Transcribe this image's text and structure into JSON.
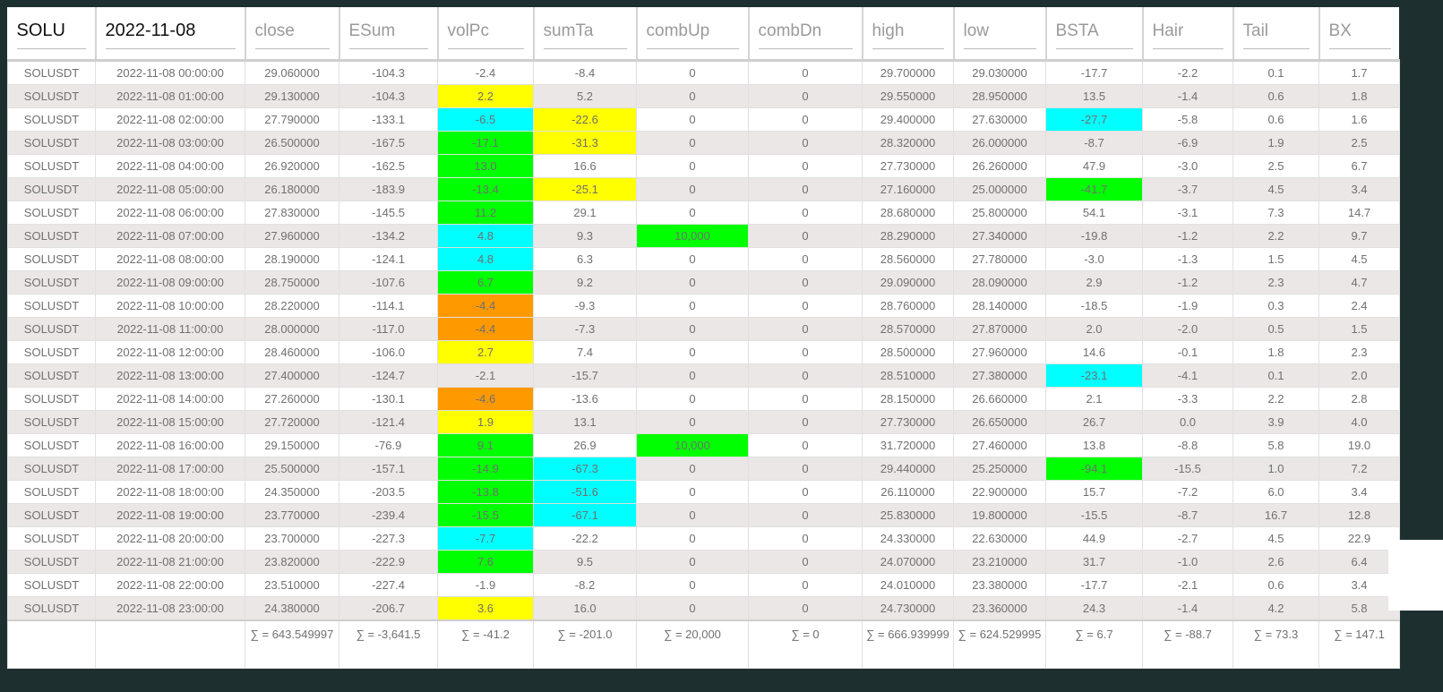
{
  "header": {
    "symbol": "SOLU",
    "date": "2022-11-08",
    "columns": [
      "close",
      "ESum",
      "volPc",
      "sumTa",
      "combUp",
      "combDn",
      "high",
      "low",
      "BSTA",
      "Hair",
      "Tail",
      "BX"
    ]
  },
  "colors": {
    "yellow": "#ffff00",
    "cyan": "#00ffff",
    "green": "#00ff00",
    "orange": "#ff9900"
  },
  "rows": [
    {
      "c": [
        "SOLUSDT",
        "2022-11-08 00:00:00",
        "29.060000",
        "-104.3",
        "-2.4",
        "-8.4",
        "0",
        "0",
        "29.700000",
        "29.030000",
        "-17.7",
        "-2.2",
        "0.1",
        "1.7"
      ],
      "hl": {}
    },
    {
      "c": [
        "SOLUSDT",
        "2022-11-08 01:00:00",
        "29.130000",
        "-104.3",
        "2.2",
        "5.2",
        "0",
        "0",
        "29.550000",
        "28.950000",
        "13.5",
        "-1.4",
        "0.6",
        "1.8"
      ],
      "hl": {
        "4": "yellow"
      }
    },
    {
      "c": [
        "SOLUSDT",
        "2022-11-08 02:00:00",
        "27.790000",
        "-133.1",
        "-6.5",
        "-22.6",
        "0",
        "0",
        "29.400000",
        "27.630000",
        "-27.7",
        "-5.8",
        "0.6",
        "1.6"
      ],
      "hl": {
        "4": "cyan",
        "5": "yellow",
        "10": "cyan"
      }
    },
    {
      "c": [
        "SOLUSDT",
        "2022-11-08 03:00:00",
        "26.500000",
        "-167.5",
        "-17.1",
        "-31.3",
        "0",
        "0",
        "28.320000",
        "26.000000",
        "-8.7",
        "-6.9",
        "1.9",
        "2.5"
      ],
      "hl": {
        "4": "green",
        "5": "yellow"
      }
    },
    {
      "c": [
        "SOLUSDT",
        "2022-11-08 04:00:00",
        "26.920000",
        "-162.5",
        "13.0",
        "16.6",
        "0",
        "0",
        "27.730000",
        "26.260000",
        "47.9",
        "-3.0",
        "2.5",
        "6.7"
      ],
      "hl": {
        "4": "green"
      }
    },
    {
      "c": [
        "SOLUSDT",
        "2022-11-08 05:00:00",
        "26.180000",
        "-183.9",
        "-13.4",
        "-25.1",
        "0",
        "0",
        "27.160000",
        "25.000000",
        "-41.7",
        "-3.7",
        "4.5",
        "3.4"
      ],
      "hl": {
        "4": "green",
        "5": "yellow",
        "10": "green"
      }
    },
    {
      "c": [
        "SOLUSDT",
        "2022-11-08 06:00:00",
        "27.830000",
        "-145.5",
        "11.2",
        "29.1",
        "0",
        "0",
        "28.680000",
        "25.800000",
        "54.1",
        "-3.1",
        "7.3",
        "14.7"
      ],
      "hl": {
        "4": "green"
      }
    },
    {
      "c": [
        "SOLUSDT",
        "2022-11-08 07:00:00",
        "27.960000",
        "-134.2",
        "4.8",
        "9.3",
        "10,000",
        "0",
        "28.290000",
        "27.340000",
        "-19.8",
        "-1.2",
        "2.2",
        "9.7"
      ],
      "hl": {
        "4": "cyan",
        "6": "green"
      }
    },
    {
      "c": [
        "SOLUSDT",
        "2022-11-08 08:00:00",
        "28.190000",
        "-124.1",
        "4.8",
        "6.3",
        "0",
        "0",
        "28.560000",
        "27.780000",
        "-3.0",
        "-1.3",
        "1.5",
        "4.5"
      ],
      "hl": {
        "4": "cyan"
      }
    },
    {
      "c": [
        "SOLUSDT",
        "2022-11-08 09:00:00",
        "28.750000",
        "-107.6",
        "6.7",
        "9.2",
        "0",
        "0",
        "29.090000",
        "28.090000",
        "2.9",
        "-1.2",
        "2.3",
        "4.7"
      ],
      "hl": {
        "4": "green"
      }
    },
    {
      "c": [
        "SOLUSDT",
        "2022-11-08 10:00:00",
        "28.220000",
        "-114.1",
        "-4.4",
        "-9.3",
        "0",
        "0",
        "28.760000",
        "28.140000",
        "-18.5",
        "-1.9",
        "0.3",
        "2.4"
      ],
      "hl": {
        "4": "orange"
      }
    },
    {
      "c": [
        "SOLUSDT",
        "2022-11-08 11:00:00",
        "28.000000",
        "-117.0",
        "-4.4",
        "-7.3",
        "0",
        "0",
        "28.570000",
        "27.870000",
        "2.0",
        "-2.0",
        "0.5",
        "1.5"
      ],
      "hl": {
        "4": "orange"
      }
    },
    {
      "c": [
        "SOLUSDT",
        "2022-11-08 12:00:00",
        "28.460000",
        "-106.0",
        "2.7",
        "7.4",
        "0",
        "0",
        "28.500000",
        "27.960000",
        "14.6",
        "-0.1",
        "1.8",
        "2.3"
      ],
      "hl": {
        "4": "yellow"
      }
    },
    {
      "c": [
        "SOLUSDT",
        "2022-11-08 13:00:00",
        "27.400000",
        "-124.7",
        "-2.1",
        "-15.7",
        "0",
        "0",
        "28.510000",
        "27.380000",
        "-23.1",
        "-4.1",
        "0.1",
        "2.0"
      ],
      "hl": {
        "10": "cyan"
      }
    },
    {
      "c": [
        "SOLUSDT",
        "2022-11-08 14:00:00",
        "27.260000",
        "-130.1",
        "-4.6",
        "-13.6",
        "0",
        "0",
        "28.150000",
        "26.660000",
        "2.1",
        "-3.3",
        "2.2",
        "2.8"
      ],
      "hl": {
        "4": "orange"
      }
    },
    {
      "c": [
        "SOLUSDT",
        "2022-11-08 15:00:00",
        "27.720000",
        "-121.4",
        "1.9",
        "13.1",
        "0",
        "0",
        "27.730000",
        "26.650000",
        "26.7",
        "0.0",
        "3.9",
        "4.0"
      ],
      "hl": {
        "4": "yellow"
      }
    },
    {
      "c": [
        "SOLUSDT",
        "2022-11-08 16:00:00",
        "29.150000",
        "-76.9",
        "9.1",
        "26.9",
        "10,000",
        "0",
        "31.720000",
        "27.460000",
        "13.8",
        "-8.8",
        "5.8",
        "19.0"
      ],
      "hl": {
        "4": "green",
        "6": "green"
      }
    },
    {
      "c": [
        "SOLUSDT",
        "2022-11-08 17:00:00",
        "25.500000",
        "-157.1",
        "-14.9",
        "-67.3",
        "0",
        "0",
        "29.440000",
        "25.250000",
        "-94.1",
        "-15.5",
        "1.0",
        "7.2"
      ],
      "hl": {
        "4": "green",
        "5": "cyan",
        "10": "green"
      }
    },
    {
      "c": [
        "SOLUSDT",
        "2022-11-08 18:00:00",
        "24.350000",
        "-203.5",
        "-13.8",
        "-51.6",
        "0",
        "0",
        "26.110000",
        "22.900000",
        "15.7",
        "-7.2",
        "6.0",
        "3.4"
      ],
      "hl": {
        "4": "green",
        "5": "cyan"
      }
    },
    {
      "c": [
        "SOLUSDT",
        "2022-11-08 19:00:00",
        "23.770000",
        "-239.4",
        "-15.5",
        "-67.1",
        "0",
        "0",
        "25.830000",
        "19.800000",
        "-15.5",
        "-8.7",
        "16.7",
        "12.8"
      ],
      "hl": {
        "4": "green",
        "5": "cyan"
      }
    },
    {
      "c": [
        "SOLUSDT",
        "2022-11-08 20:00:00",
        "23.700000",
        "-227.3",
        "-7.7",
        "-22.2",
        "0",
        "0",
        "24.330000",
        "22.630000",
        "44.9",
        "-2.7",
        "4.5",
        "22.9"
      ],
      "hl": {
        "4": "cyan"
      }
    },
    {
      "c": [
        "SOLUSDT",
        "2022-11-08 21:00:00",
        "23.820000",
        "-222.9",
        "7.6",
        "9.5",
        "0",
        "0",
        "24.070000",
        "23.210000",
        "31.7",
        "-1.0",
        "2.6",
        "6.4"
      ],
      "hl": {
        "4": "green"
      }
    },
    {
      "c": [
        "SOLUSDT",
        "2022-11-08 22:00:00",
        "23.510000",
        "-227.4",
        "-1.9",
        "-8.2",
        "0",
        "0",
        "24.010000",
        "23.380000",
        "-17.7",
        "-2.1",
        "0.6",
        "3.4"
      ],
      "hl": {}
    },
    {
      "c": [
        "SOLUSDT",
        "2022-11-08 23:00:00",
        "24.380000",
        "-206.7",
        "3.6",
        "16.0",
        "0",
        "0",
        "24.730000",
        "23.360000",
        "24.3",
        "-1.4",
        "4.2",
        "5.8"
      ],
      "hl": {
        "4": "yellow"
      }
    }
  ],
  "footer": [
    "",
    "",
    "∑ = 643.549997",
    "∑ = -3,641.5",
    "∑ = -41.2",
    "∑ = -201.0",
    "∑ = 20,000",
    "∑ = 0",
    "∑ = 666.939999",
    "∑ = 624.529995",
    "∑ = 6.7",
    "∑ = -88.7",
    "∑ = 73.3",
    "∑ = 147.1"
  ]
}
